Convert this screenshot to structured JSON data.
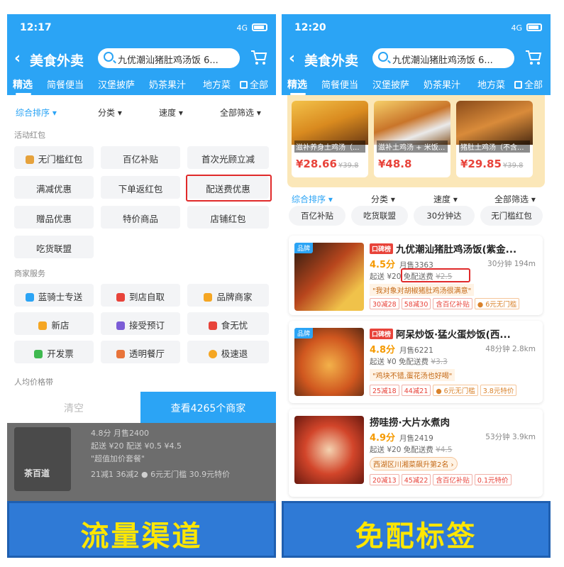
{
  "left": {
    "status": {
      "time": "12:17",
      "signal": "4G"
    },
    "nav": {
      "back": "‹",
      "title": "美食外卖",
      "search": "九优潮汕猪肚鸡汤饭 6..."
    },
    "tabs": [
      "精选",
      "简餐便当",
      "汉堡披萨",
      "奶茶果汁",
      "地方菜",
      "全部"
    ],
    "sort": [
      "综合排序",
      "分类",
      "速度",
      "全部筛选"
    ],
    "section_promo": "活动红包",
    "promo_chips": [
      "无门槛红包",
      "百亿补贴",
      "首次光顾立减",
      "满减优惠",
      "下单返红包",
      "配送费优惠",
      "赠品优惠",
      "特价商品",
      "店铺红包",
      "吃货联盟"
    ],
    "section_service": "商家服务",
    "service_chips": [
      "蓝骑士专送",
      "到店自取",
      "品牌商家",
      "新店",
      "接受预订",
      "食无忧",
      "开发票",
      "透明餐厅",
      "极速退"
    ],
    "section_price": "人均价格带",
    "clear": "清空",
    "view": "查看4265个商家",
    "dimmed_lines": [
      "4.8分  月售2400",
      "起送 ¥20  配送 ¥0.5 ¥4.5",
      "\"超值加价套餐\"",
      "21减1  36减2  ● 6元无门槛  30.9元特价"
    ],
    "dimmed_logo": "茶百道",
    "caption": "流量渠道"
  },
  "right": {
    "status": {
      "time": "12:20",
      "signal": "4G"
    },
    "nav": {
      "back": "‹",
      "title": "美食外卖",
      "search": "九优潮汕猪肚鸡汤饭 6..."
    },
    "tabs": [
      "精选",
      "简餐便当",
      "汉堡披萨",
      "奶茶果汁",
      "地方菜",
      "全部"
    ],
    "dishes": [
      {
        "name": "滋补养身土鸡汤（...",
        "price": "¥28.66",
        "old": "¥39.8"
      },
      {
        "name": "滋补土鸡汤 + 米饭...",
        "price": "¥48.8",
        "old": ""
      },
      {
        "name": "猪肚土鸡汤（不含...",
        "price": "¥29.85",
        "old": "¥39.8"
      }
    ],
    "sort": [
      "综合排序",
      "分类",
      "速度",
      "全部筛选"
    ],
    "promo_chips": [
      "百亿补贴",
      "吃货联盟",
      "30分钟达",
      "无门槛红包"
    ],
    "shops": [
      {
        "brand": "品牌",
        "badge": "口碑榜",
        "name": "九优潮汕猪肚鸡汤饭(紫金...",
        "score": "4.5分",
        "sales": "月售3363",
        "time": "30分钟  194m",
        "delivery": "起送 ¥20  免配送费",
        "delivery_old": "¥2.5",
        "quote": "\"我对象对胡椒猪肚鸡汤很满意\"",
        "tags": [
          "30减28",
          "58减30",
          "含百亿补贴"
        ],
        "extra": "● 6元无门槛"
      },
      {
        "brand": "品牌",
        "badge": "口碑榜",
        "name": "阿呆炒饭·猛火蛋炒饭(西...",
        "score": "4.8分",
        "sales": "月售6221",
        "time": "48分钟  2.8km",
        "delivery": "起送 ¥0  免配送费",
        "delivery_old": "¥3.3",
        "quote": "\"鸡块不错,蛋花汤也好喝\"",
        "tags": [
          "25减18",
          "44减21",
          "● 6元无门槛"
        ],
        "extra": "3.8元特价"
      },
      {
        "brand": "",
        "badge": "",
        "name": "捞哇捞·大片水煮肉",
        "score": "4.9分",
        "sales": "月售2419",
        "time": "53分钟  3.9km",
        "delivery": "起送 ¥20  免配送费",
        "delivery_old": "¥4.5",
        "quote": "西湖区川湘菜飙升第2名 ›",
        "tags": [
          "20减13",
          "45减22",
          "含百亿补贴"
        ],
        "extra": "0.1元特价"
      }
    ],
    "caption": "免配标签"
  }
}
